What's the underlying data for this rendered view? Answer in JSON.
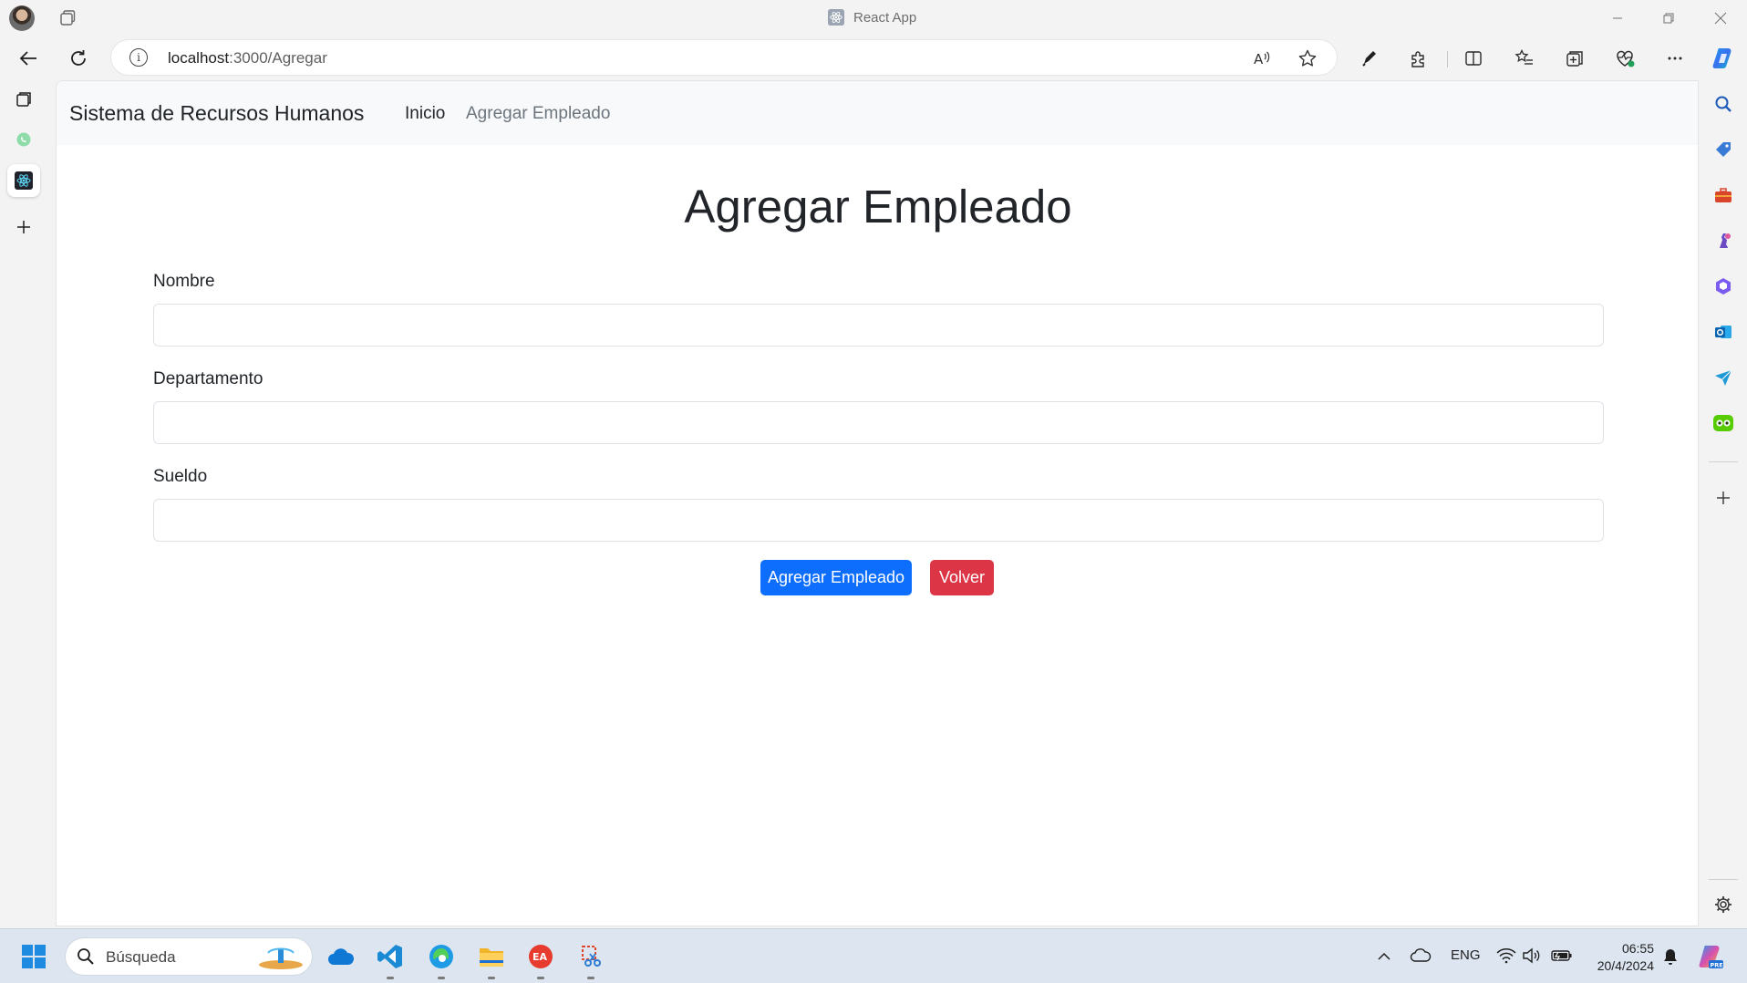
{
  "window": {
    "title": "React App",
    "controls": [
      "minimize",
      "restore",
      "close"
    ]
  },
  "addressbar": {
    "host": "localhost",
    "path": ":3000/Agregar"
  },
  "page": {
    "navbar": {
      "brand": "Sistema de Recursos Humanos",
      "links": [
        {
          "label": "Inicio",
          "active": true
        },
        {
          "label": "Agregar Empleado",
          "active": false
        }
      ]
    },
    "title": "Agregar Empleado",
    "form": {
      "fields": [
        {
          "label": "Nombre",
          "value": ""
        },
        {
          "label": "Departamento",
          "value": ""
        },
        {
          "label": "Sueldo",
          "value": ""
        }
      ],
      "submit_label": "Agregar Empleado",
      "back_label": "Volver"
    }
  },
  "taskbar": {
    "search_placeholder": "Búsqueda",
    "language": "ENG",
    "time": "06:55",
    "date": "20/4/2024"
  },
  "colors": {
    "primary": "#0d6efd",
    "danger": "#dc3545",
    "navbar_bg": "#f8f9fa"
  }
}
